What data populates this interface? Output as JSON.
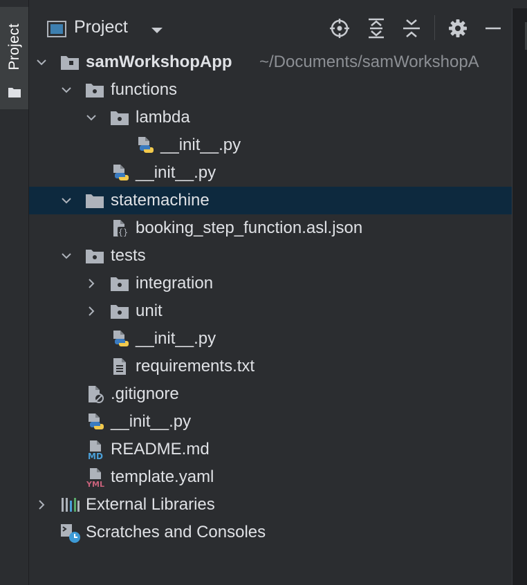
{
  "sidebar": {
    "tab_label": "Project"
  },
  "header": {
    "title": "Project",
    "icons": [
      "locate-icon",
      "expand-all-icon",
      "collapse-all-icon",
      "gear-icon",
      "hide-icon"
    ]
  },
  "tree": {
    "root": {
      "label": "samWorkshopApp",
      "path": "~/Documents/samWorkshopA"
    },
    "functions": "functions",
    "lambda": "lambda",
    "lambda_init": "__init__.py",
    "functions_init": "__init__.py",
    "statemachine": "statemachine",
    "asl": "booking_step_function.asl.json",
    "tests": "tests",
    "integration": "integration",
    "unit": "unit",
    "tests_init": "__init__.py",
    "requirements": "requirements.txt",
    "gitignore": ".gitignore",
    "root_init": "__init__.py",
    "readme": "README.md",
    "template": "template.yaml",
    "external": "External Libraries",
    "scratches": "Scratches and Consoles"
  },
  "badges": {
    "md": "MD",
    "yml": "YML"
  },
  "colors": {
    "background": "#2b2d30",
    "selection": "#0d293e",
    "text": "#dfe1e5",
    "path_text": "#8c8f94",
    "folder": "#aeb3bb",
    "python_blue": "#3b7bbf",
    "python_yellow": "#f2c94c",
    "md_badge": "#4a9fd8",
    "yml_badge": "#c7617a"
  }
}
